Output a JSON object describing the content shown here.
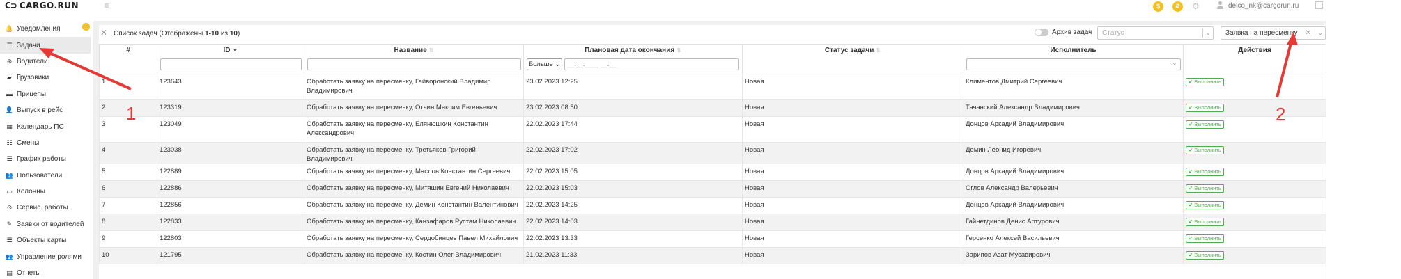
{
  "app": {
    "logo_mark": "C⊃",
    "logo_text": "CARGO.RUN",
    "menu_icon": "≡",
    "user_email": "delco_nk@cargorun.ru",
    "notif_count": "!",
    "coin_a": "$",
    "coin_b": "₽"
  },
  "sidebar": {
    "items": [
      {
        "label": "Уведомления",
        "icon": "bell-icon",
        "glyph": "🔔"
      },
      {
        "label": "Задачи",
        "icon": "list-icon",
        "glyph": "☰"
      },
      {
        "label": "Водители",
        "icon": "steering-icon",
        "glyph": "⊛"
      },
      {
        "label": "Грузовики",
        "icon": "truck-icon",
        "glyph": "▰"
      },
      {
        "label": "Прицепы",
        "icon": "trailer-icon",
        "glyph": "▬"
      },
      {
        "label": "Выпуск в рейс",
        "icon": "people-icon",
        "glyph": "👤"
      },
      {
        "label": "Календарь ПС",
        "icon": "calendar-icon",
        "glyph": "▦"
      },
      {
        "label": "Смены",
        "icon": "shift-icon",
        "glyph": "☷"
      },
      {
        "label": "График работы",
        "icon": "schedule-icon",
        "glyph": "☰"
      },
      {
        "label": "Пользователи",
        "icon": "users-icon",
        "glyph": "👥"
      },
      {
        "label": "Колонны",
        "icon": "column-icon",
        "glyph": "▭"
      },
      {
        "label": "Сервис. работы",
        "icon": "service-icon",
        "glyph": "⊙"
      },
      {
        "label": "Заявки от водителей",
        "icon": "wrench-icon",
        "glyph": "✎"
      },
      {
        "label": "Объекты карты",
        "icon": "map-objects-icon",
        "glyph": "☰"
      },
      {
        "label": "Управление ролями",
        "icon": "roles-icon",
        "glyph": "👥"
      },
      {
        "label": "Отчеты",
        "icon": "report-icon",
        "glyph": "▤"
      }
    ],
    "active_index": 1
  },
  "panel": {
    "title_prefix": "Список задач (Отображены ",
    "title_range": "1-10",
    "title_mid": " из ",
    "title_total": "10",
    "title_suffix": ")",
    "archive_label": "Архив задач",
    "status_placeholder": "Статус",
    "type_value": "Заявка на пересменку"
  },
  "table": {
    "columns": {
      "num": "#",
      "id": "ID",
      "name": "Название",
      "date": "Плановая дата окончания",
      "status": "Статус задачи",
      "exec": "Исполнитель",
      "actions": "Действия"
    },
    "date_filter_op": "Больше",
    "date_filter_placeholder": "__.__.____ __:__",
    "action_label": "Выполнить",
    "rows": [
      {
        "n": "1",
        "id": "123643",
        "name": "Обработать заявку на пересменку, Гайворонский Владимир Владимирович",
        "date": "23.02.2023 12:25",
        "status": "Новая",
        "exec": "Климентов Дмитрий Сергеевич"
      },
      {
        "n": "2",
        "id": "123319",
        "name": "Обработать заявку на пересменку, Отчин Максим Евгеньевич",
        "date": "23.02.2023 08:50",
        "status": "Новая",
        "exec": "Тачанский Александр Владимирович"
      },
      {
        "n": "3",
        "id": "123049",
        "name": "Обработать заявку на пересменку, Елянюшкин Константин Александрович",
        "date": "22.02.2023 17:44",
        "status": "Новая",
        "exec": "Донцов Аркадий Владимирович"
      },
      {
        "n": "4",
        "id": "123038",
        "name": "Обработать заявку на пересменку, Третьяков Григорий Владимирович",
        "date": "22.02.2023 17:02",
        "status": "Новая",
        "exec": "Демин Леонид Игоревич"
      },
      {
        "n": "5",
        "id": "122889",
        "name": "Обработать заявку на пересменку, Маслов Константин Сергеевич",
        "date": "22.02.2023 15:05",
        "status": "Новая",
        "exec": "Донцов Аркадий Владимирович"
      },
      {
        "n": "6",
        "id": "122886",
        "name": "Обработать заявку на пересменку, Митяшин Евгений Николаевич",
        "date": "22.02.2023 15:03",
        "status": "Новая",
        "exec": "Оглов Александр Валерьевич"
      },
      {
        "n": "7",
        "id": "122856",
        "name": "Обработать заявку на пересменку, Демин Константин Валентинович",
        "date": "22.02.2023 14:25",
        "status": "Новая",
        "exec": "Донцов Аркадий Владимирович"
      },
      {
        "n": "8",
        "id": "122833",
        "name": "Обработать заявку на пересменку, Канзафаров Рустам Николаевич",
        "date": "22.02.2023 14:03",
        "status": "Новая",
        "exec": "Гайнетдинов Денис Артурович"
      },
      {
        "n": "9",
        "id": "122803",
        "name": "Обработать заявку на пересменку, Сердобинцев Павел Михайлович",
        "date": "22.02.2023 13:33",
        "status": "Новая",
        "exec": "Герсенко Алексей Васильевич"
      },
      {
        "n": "10",
        "id": "121795",
        "name": "Обработать заявку на пересменку, Костин Олег Владимирович",
        "date": "21.02.2023 11:33",
        "status": "Новая",
        "exec": "Зарипов Азат Мусавирович"
      }
    ]
  },
  "annotations": {
    "label_1": "1",
    "label_2": "2",
    "color": "#e53935"
  }
}
